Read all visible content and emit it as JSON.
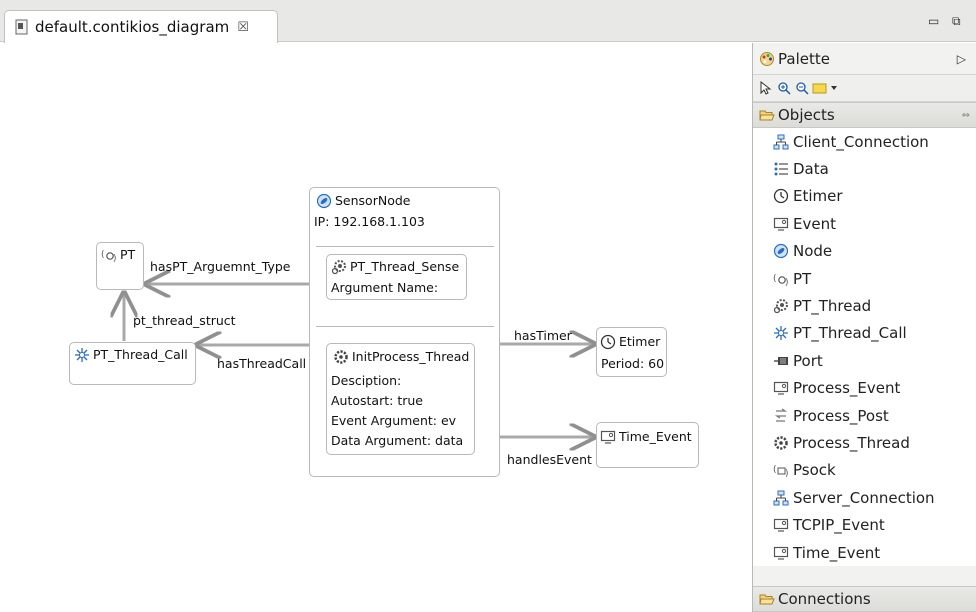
{
  "editor": {
    "tab_title": "default.contikios_diagram",
    "close_glyph": "☒",
    "minimize_glyph": "▭",
    "maximize_glyph": "⧉"
  },
  "diagram": {
    "sensor_node": {
      "title": "SensorNode",
      "ip": "IP: 192.168.1.103"
    },
    "pt_thread_sense": {
      "title": "PT_Thread_Sense",
      "argument": "Argument Name:"
    },
    "init_process_thread": {
      "title": "InitProcess_Thread",
      "description": "Desciption:",
      "autostart": "Autostart: true",
      "event_argument": "Event Argument: ev",
      "data_argument": "Data Argument: data"
    },
    "pt": {
      "title": "PT"
    },
    "pt_thread_call": {
      "title": "PT_Thread_Call"
    },
    "etimer": {
      "title": "Etimer",
      "period": "Period: 60"
    },
    "time_event": {
      "title": "Time_Event"
    },
    "edges": {
      "has_pt_argument_type": "hasPT_Arguemnt_Type",
      "pt_thread_struct": "pt_thread_struct",
      "has_thread_call": "hasThreadCall",
      "has_timer": "hasTimer",
      "handles_event": "handlesEvent"
    }
  },
  "palette": {
    "title": "Palette",
    "collapse_glyph": "▷",
    "objects_label": "Objects",
    "connections_label": "Connections",
    "items": [
      {
        "label": "Client_Connection",
        "icon": "network-icon"
      },
      {
        "label": "Data",
        "icon": "list-icon"
      },
      {
        "label": "Etimer",
        "icon": "timer-icon"
      },
      {
        "label": "Event",
        "icon": "monitor-icon"
      },
      {
        "label": "Node",
        "icon": "node-icon"
      },
      {
        "label": "PT",
        "icon": "pt-icon"
      },
      {
        "label": "PT_Thread",
        "icon": "gear-icon"
      },
      {
        "label": "PT_Thread_Call",
        "icon": "spark-icon"
      },
      {
        "label": "Port",
        "icon": "port-icon"
      },
      {
        "label": "Process_Event",
        "icon": "monitor-icon"
      },
      {
        "label": "Process_Post",
        "icon": "post-icon"
      },
      {
        "label": "Process_Thread",
        "icon": "cog-icon"
      },
      {
        "label": "Psock",
        "icon": "psock-icon"
      },
      {
        "label": "Server_Connection",
        "icon": "network-icon"
      },
      {
        "label": "TCPIP_Event",
        "icon": "monitor-icon"
      },
      {
        "label": "Time_Event",
        "icon": "monitor-icon"
      }
    ]
  }
}
